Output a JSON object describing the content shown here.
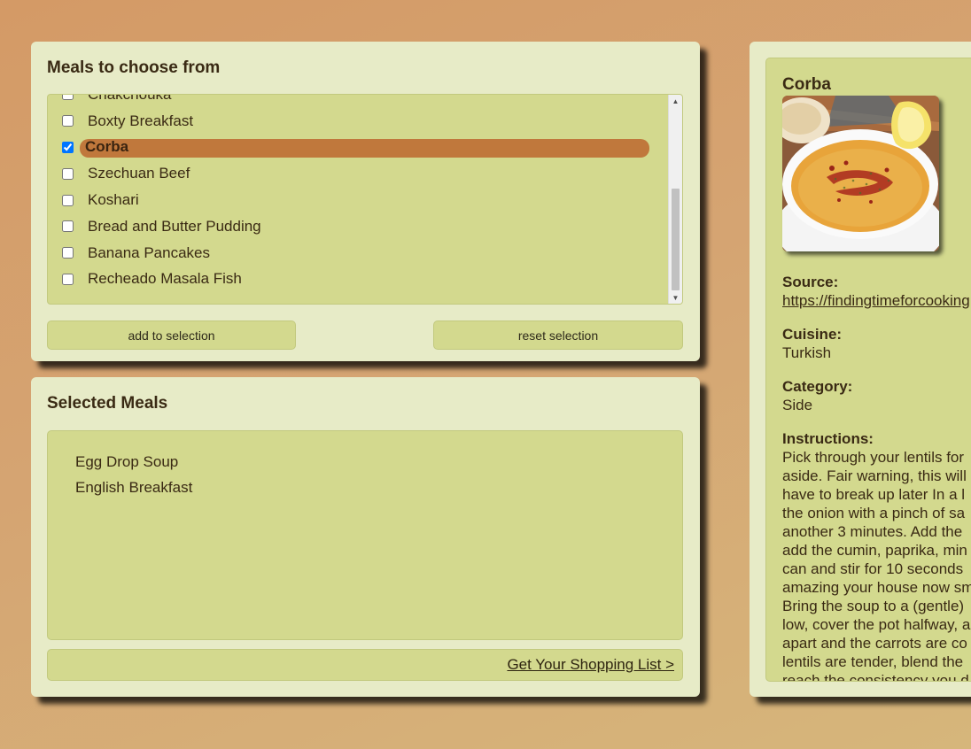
{
  "meals_panel": {
    "title": "Meals to choose from",
    "items": [
      {
        "label": "Chakchouka",
        "checked": false
      },
      {
        "label": "Boxty Breakfast",
        "checked": false
      },
      {
        "label": "Corba",
        "checked": true
      },
      {
        "label": "Szechuan Beef",
        "checked": false
      },
      {
        "label": "Koshari",
        "checked": false
      },
      {
        "label": "Bread and Butter Pudding",
        "checked": false
      },
      {
        "label": "Banana Pancakes",
        "checked": false
      },
      {
        "label": "Recheado Masala Fish",
        "checked": false
      }
    ],
    "add_button": "add to selection",
    "reset_button": "reset selection"
  },
  "selected_panel": {
    "title": "Selected Meals",
    "items": [
      "Egg Drop Soup",
      "English Breakfast"
    ],
    "shopping_link": "Get Your Shopping List >"
  },
  "details": {
    "title": "Corba",
    "source_label": "Source:",
    "source_value": "https://findingtimeforcooking",
    "cuisine_label": "Cuisine:",
    "cuisine_value": "Turkish",
    "category_label": "Category:",
    "category_value": "Side",
    "instructions_label": "Instructions:",
    "instructions_lines": [
      "Pick through your lentils for",
      "aside. Fair warning, this will",
      "have to break up later In a l",
      "the onion with a pinch of sa",
      "another 3 minutes. Add the",
      "add the cumin, paprika, min",
      "can and stir for 10 seconds",
      "amazing your house now sm",
      "Bring the soup to a (gentle)",
      "low, cover the pot halfway, a",
      "apart and the carrots are co",
      "lentils are tender, blend the",
      "reach the consistency you d"
    ]
  },
  "colors": {
    "background": "#d4a06c",
    "panel": "#e7ebc7",
    "inner": "#d3d98e",
    "highlight": "#c0783c"
  }
}
